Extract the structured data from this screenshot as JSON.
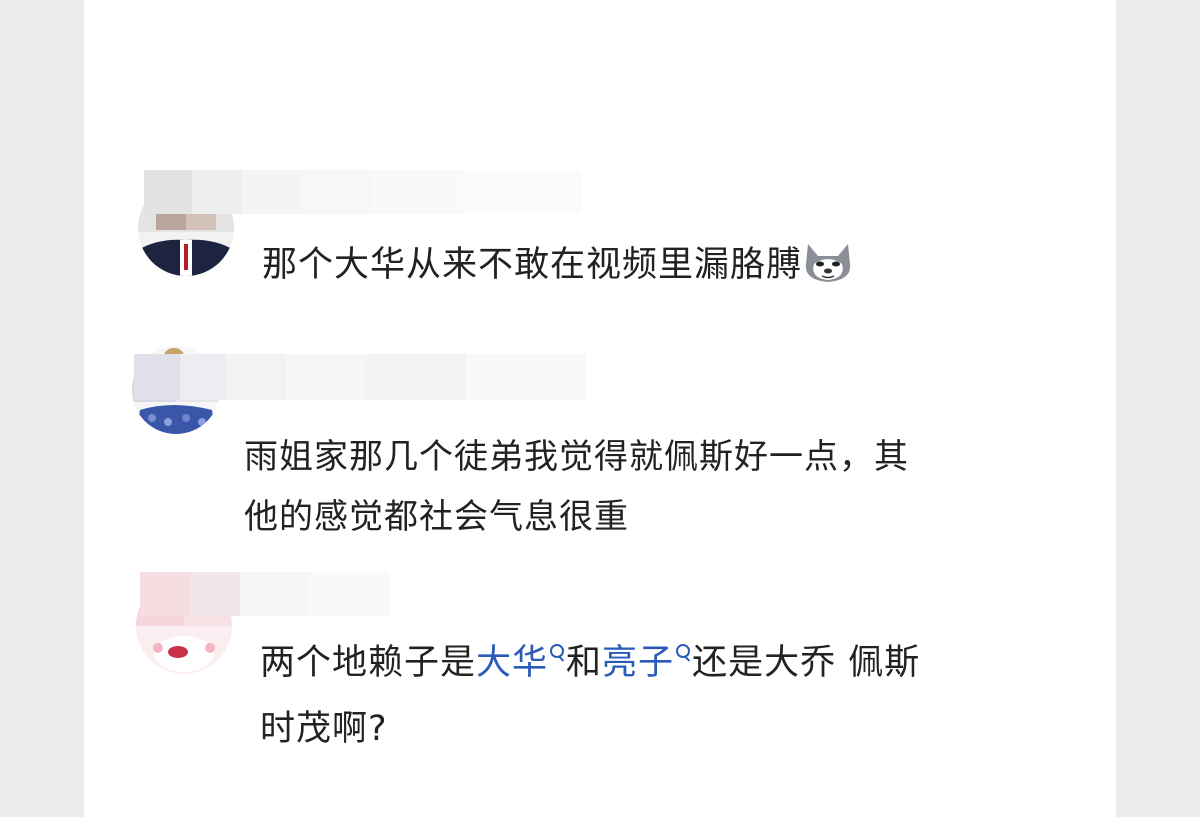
{
  "comments": [
    {
      "text": "那个大华从来不敢在视频里漏胳膊",
      "emoji": "husky-emoji"
    },
    {
      "line1": "雨姐家那几个徒弟我觉得就佩斯好一点，其",
      "line2": "他的感觉都社会气息很重"
    },
    {
      "part1": "两个地赖子是",
      "link1": "大华",
      "part2": "和",
      "link2": "亮子",
      "part3": "还是大乔 佩斯",
      "line2": "时茂啊?"
    }
  ],
  "colors": {
    "text": "#222222",
    "link": "#2a5bb8",
    "background": "#ffffff"
  }
}
